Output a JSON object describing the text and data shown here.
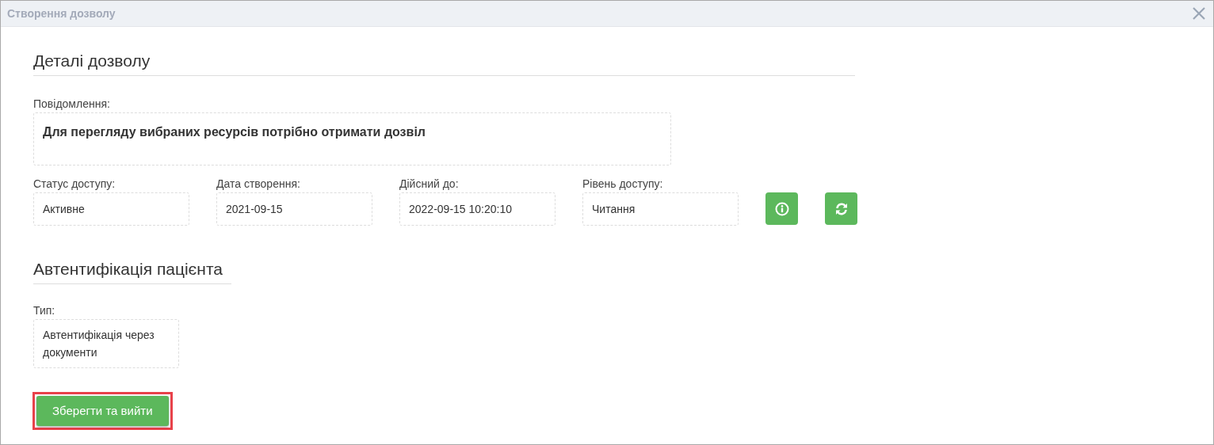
{
  "window": {
    "title": "Створення дозволу"
  },
  "details": {
    "heading": "Деталі дозволу",
    "message_label": "Повідомлення:",
    "message": "Для перегляду вибраних ресурсів потрібно отримати дозвіл",
    "fields": [
      {
        "label": "Статус доступу:",
        "value": "Активне"
      },
      {
        "label": "Дата створення:",
        "value": "2021-09-15"
      },
      {
        "label": "Дійсний до:",
        "value": "2022-09-15 10:20:10"
      },
      {
        "label": "Рівень доступу:",
        "value": "Читання"
      }
    ],
    "actions": [
      {
        "kind": "info"
      },
      {
        "kind": "refresh"
      }
    ]
  },
  "authentication": {
    "heading": "Автентифікація пацієнта",
    "type_label": "Тип:",
    "type_value": "Автентифікація через документи"
  },
  "save_button": {
    "label": "Зберегти та вийти",
    "highlighted": true
  }
}
